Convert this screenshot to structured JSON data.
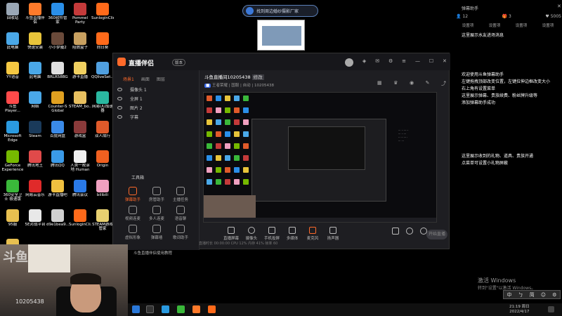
{
  "desktop_icons": [
    {
      "label": "回收站",
      "color": "#9aa7b5"
    },
    {
      "label": "斗鱼直播伴侣",
      "color": "#ff7a2a"
    },
    {
      "label": "360软件管家",
      "color": "#2a8fe8"
    },
    {
      "label": "Pommel Party",
      "color": "#c43a3a"
    },
    {
      "label": "SunloginClient",
      "color": "#ff6a1a"
    },
    {
      "label": "此电脑",
      "color": "#4aa8e8"
    },
    {
      "label": "快速安装",
      "color": "#e8c43a"
    },
    {
      "label": "小小梦魇2",
      "color": "#6a4a3a"
    },
    {
      "label": "阻燃盒子",
      "color": "#c8a060"
    },
    {
      "label": "向日葵",
      "color": "#ff6a1a"
    },
    {
      "label": "YY语音",
      "color": "#f5c842"
    },
    {
      "label": "此电脑",
      "color": "#4aa8e8"
    },
    {
      "label": "BRLR58BG",
      "color": "#e0e0e0"
    },
    {
      "label": "游卡直播",
      "color": "#f0d060"
    },
    {
      "label": "QQliveSet...",
      "color": "#50a0e0"
    },
    {
      "label": "斗鱼Player...",
      "color": "#ff4a4a"
    },
    {
      "label": "网络",
      "color": "#4aa8e8"
    },
    {
      "label": "Counter-S Global Off...",
      "color": "#e0a020"
    },
    {
      "label": "STEAM_bo...",
      "color": "#e8c060"
    },
    {
      "label": "网易UU加速器",
      "color": "#2ab8a0"
    },
    {
      "label": "Microsoft Edge",
      "color": "#2a9ae0"
    },
    {
      "label": "Steam",
      "color": "#1a3a5a"
    },
    {
      "label": "百度网盘",
      "color": "#3a8ae8"
    },
    {
      "label": "游戏盒",
      "color": "#8a3a3a"
    },
    {
      "label": "双人成行",
      "color": "#e05a2a"
    },
    {
      "label": "GeForce Experience",
      "color": "#76b900"
    },
    {
      "label": "腾讯地王",
      "color": "#e04a4a"
    },
    {
      "label": "腾讯QQ",
      "color": "#3a9ae8"
    },
    {
      "label": "人类一败涂地 Human Fal...",
      "color": "#f0f0f0"
    },
    {
      "label": "Origin",
      "color": "#f06020"
    },
    {
      "label": "360安全卫士 极速版",
      "color": "#3ab83a"
    },
    {
      "label": "网易云音乐",
      "color": "#e02a2a"
    },
    {
      "label": "游卡直播吧",
      "color": "#f0c040"
    },
    {
      "label": "腾讯会议",
      "color": "#2a7ae8"
    },
    {
      "label": "bilibili",
      "color": "#f0a0c0"
    },
    {
      "label": "95服",
      "color": "#e8c050"
    },
    {
      "label": "5E对战平台",
      "color": "#e8e8e8"
    },
    {
      "label": "d9e1bea9...",
      "color": "#d0d0d0"
    },
    {
      "label": "SunloginCli...",
      "color": "#ff6a1a"
    },
    {
      "label": "STEAM游戏管家",
      "color": "#e8d070"
    },
    {
      "label": "95服",
      "color": "#e8c050"
    }
  ],
  "search": {
    "text": "找到周边婚纱摄影厂家"
  },
  "right_panel": {
    "title": "弹幕助手",
    "stats": [
      "12",
      "3",
      "5005"
    ],
    "tabs": [
      "设置项",
      "设置项",
      "设置项",
      "设置项"
    ],
    "lines": [
      "这里展示水友进场消息",
      "欢迎使用斗鱼弹幕助手",
      "左键拖拽顶部改变位置，左键拉伸边框改变大小",
      "右上角有设置菜单",
      "这里展示弹幕、贵族续费、粉丝牌升级等",
      "添加弹幕助手成功",
      "这里展示收到的礼物、道具、贵族开通",
      "点菜单可设置小礼物屏蔽"
    ]
  },
  "activation": {
    "line1": "激活 Windows",
    "line2": "转到\"设置\"以激活 Windows。"
  },
  "ime": [
    "中",
    "ㄅ",
    "简",
    "☺",
    "⚙"
  ],
  "app": {
    "title": "直播伴侣",
    "version": "版本",
    "left_tabs": [
      "场景1",
      "画面",
      "图层"
    ],
    "sources": [
      "摄像头 1",
      "全屏 1",
      "图片 2",
      "字幕"
    ],
    "tools_label": "工具箱",
    "tools": [
      {
        "label": "弹幕助手",
        "hot": true
      },
      {
        "label": "房管助手",
        "hot": false
      },
      {
        "label": "主播任务",
        "hot": false
      },
      {
        "label": "视频连麦",
        "hot": false
      },
      {
        "label": "多人连麦",
        "hot": false
      },
      {
        "label": "语音聊",
        "hot": false
      },
      {
        "label": "虚拟形象",
        "hot": false
      },
      {
        "label": "弹幕墙",
        "hot": false
      },
      {
        "label": "歌词助手",
        "hot": false
      }
    ],
    "room_title": "斗鱼直播间10205438",
    "room_edit": "修改",
    "room_sub": "王者荣耀 | 国服 | 自动 | 10205438",
    "bottom_tools": [
      "直播屏幕",
      "摄像头",
      "手机投屏",
      "多媒体",
      "麦克风",
      "扬声器"
    ],
    "live_button": "开始直播",
    "status": "直播时长 00:00:00   CPU 12%   内存 41%   帧率 60"
  },
  "chat_notice": "斗鱼直播伴侣使用教程",
  "webcam": {
    "watermark": "斗鱼",
    "room_id": "10205438"
  },
  "taskbar": {
    "time": "21:19 周日",
    "date": "2022/4/17"
  }
}
